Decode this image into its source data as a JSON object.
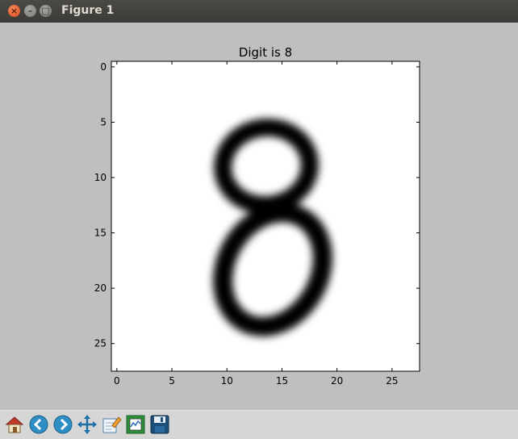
{
  "window": {
    "title": "Figure 1",
    "close_glyph": "×",
    "min_glyph": "–",
    "max_glyph": "□"
  },
  "chart_data": {
    "type": "heatmap",
    "title": "Digit is 8",
    "xlabel": "",
    "ylabel": "",
    "xlim": [
      -0.5,
      27.5
    ],
    "ylim": [
      27.5,
      -0.5
    ],
    "xticks": [
      "0",
      "5",
      "10",
      "15",
      "20",
      "25"
    ],
    "yticks": [
      "0",
      "5",
      "10",
      "15",
      "20",
      "25"
    ],
    "colormap": "gray_r",
    "grid": false
  },
  "toolbar": {
    "items": [
      {
        "name": "home-icon"
      },
      {
        "name": "back-icon"
      },
      {
        "name": "forward-icon"
      },
      {
        "name": "pan-icon"
      },
      {
        "name": "zoom-icon"
      },
      {
        "name": "configure-subplots-icon"
      },
      {
        "name": "save-icon"
      }
    ]
  }
}
